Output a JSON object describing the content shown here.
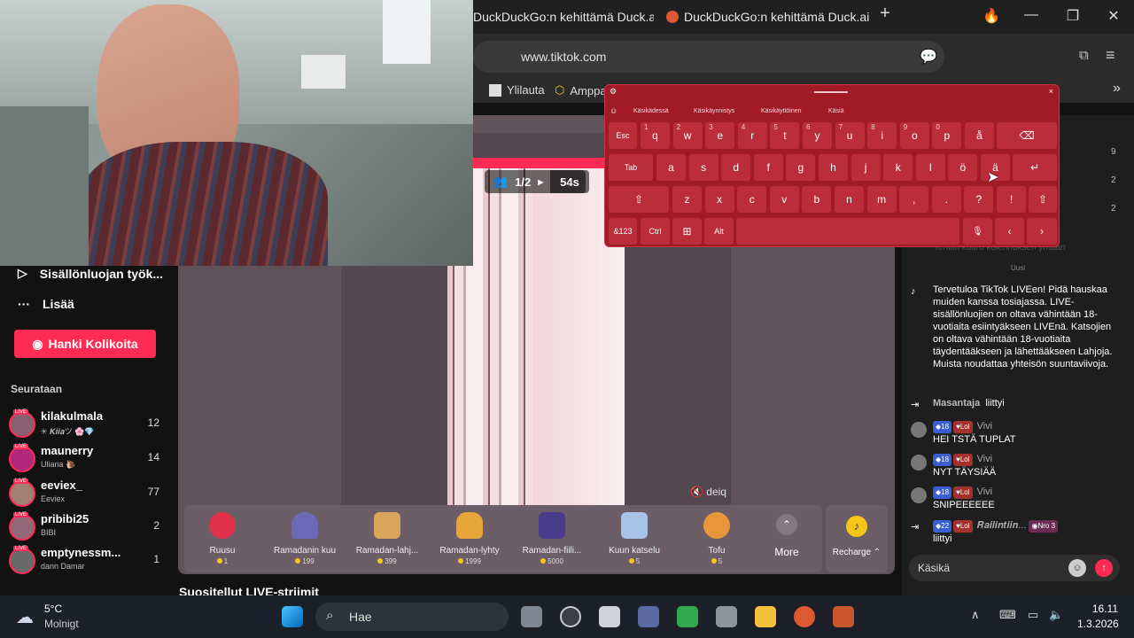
{
  "browser": {
    "tabs": [
      {
        "label": "DuckDuckGo:n kehittämä Duck.ai"
      },
      {
        "label": "DuckDuckGo:n kehittämä Duck.ai"
      }
    ],
    "new_tab": "+",
    "url": "www.tiktok.com",
    "bookmarks": [
      "Ylilauta",
      "Amppa"
    ]
  },
  "sidebar": {
    "creator_tools": "Sisällönluojan työk...",
    "more": "Lisää",
    "get_coins": "Hanki Kolikoita",
    "following_title": "Seurataan",
    "following": [
      {
        "name": "kilakulmala",
        "sub": "✳ 𝑲𝒊𝒊𝒂ツ 🌸💎",
        "count": "12"
      },
      {
        "name": "maunerry",
        "sub": "Uliana 🐌",
        "count": "14"
      },
      {
        "name": "eeviex_",
        "sub": "Eeviex",
        "count": "77"
      },
      {
        "name": "pribibi25",
        "sub": "BIBI",
        "count": "2"
      },
      {
        "name": "emptynessm...",
        "sub": "dann Damar",
        "count": "1"
      }
    ],
    "recommended": "Suositellut LIVE-striimit"
  },
  "player": {
    "round": "1/2",
    "timer": "54s",
    "host": "deiq"
  },
  "gifts": [
    {
      "name": "Ruusu",
      "price": "1",
      "color": "#e0304a"
    },
    {
      "name": "Ramadanin kuu",
      "price": "199",
      "color": "#6c6ab8"
    },
    {
      "name": "Ramadan-lahj...",
      "price": "399",
      "color": "#d9a55c"
    },
    {
      "name": "Ramadan-lyhty",
      "price": "1999",
      "color": "#e8a53a"
    },
    {
      "name": "Ramadan-fiili...",
      "price": "5000",
      "color": "#4a3c8c"
    },
    {
      "name": "Kuun katselu",
      "price": "5",
      "color": "#a9c3e8"
    },
    {
      "name": "Tofu",
      "price": "5",
      "color": "#e8963a"
    }
  ],
  "gift_more": "More",
  "recharge": "Recharge",
  "chat": {
    "side_counts": [
      "9",
      "2",
      "2"
    ],
    "faded": "Tehtiin kuuro koiennuksen yhtään",
    "new_label": "Uusi",
    "welcome": "Tervetuloa TikTok LIVEen! Pidä hauskaa muiden kanssa tosiajassa. LIVE-sisällönluojien on oltava vähintään 18-vuotiaita esiintyäkseen LIVEnä. Katsojien on oltava vähintään 18-vuotiaita täydentääkseen ja lähettääkseen Lahjoja. Muista noudattaa yhteisön suuntaviivoja.",
    "joined1_name": "Masantaja",
    "joined_text": "liittyi",
    "messages": [
      {
        "level": "18",
        "tag": "Lol",
        "user": "Vivi",
        "text": "HEI TSTÄ TUPLAT"
      },
      {
        "level": "18",
        "tag": "Lol",
        "user": "Vivi",
        "text": "NYT TÄYSIÄÄ"
      },
      {
        "level": "18",
        "tag": "Lol",
        "user": "Vivi",
        "text": "SNIPEEEEEE"
      }
    ],
    "joined2": {
      "level": "22",
      "tag": "Lol",
      "user": "𝑹𝒂𝒊𝒍𝒊𝒏𝒕𝒊𝒊𝒏...",
      "rank": "Nro 3"
    },
    "input_value": "Käsikä"
  },
  "keyboard": {
    "modes": [
      "Käsikädessä",
      "Käsikäynnistys",
      "Käsikäyttöinen",
      "Käsiä"
    ],
    "row1": [
      "Esc",
      "q",
      "w",
      "e",
      "r",
      "t",
      "y",
      "u",
      "i",
      "o",
      "p",
      "å"
    ],
    "row1_nums": [
      "",
      "1",
      "2",
      "3",
      "4",
      "5",
      "6",
      "7",
      "8",
      "9",
      "0",
      ""
    ],
    "row2": [
      "Tab",
      "a",
      "s",
      "d",
      "f",
      "g",
      "h",
      "j",
      "k",
      "l",
      "ö",
      "ä"
    ],
    "row3": [
      "z",
      "x",
      "c",
      "v",
      "b",
      "n",
      "m",
      ",",
      ".",
      "?",
      "!"
    ],
    "row4": [
      "&123",
      "Ctrl",
      "Alt"
    ]
  },
  "taskbar": {
    "temp": "5°C",
    "weather": "Molnigt",
    "search": "Hae",
    "time": "16.11",
    "date": "1.3.2026"
  }
}
